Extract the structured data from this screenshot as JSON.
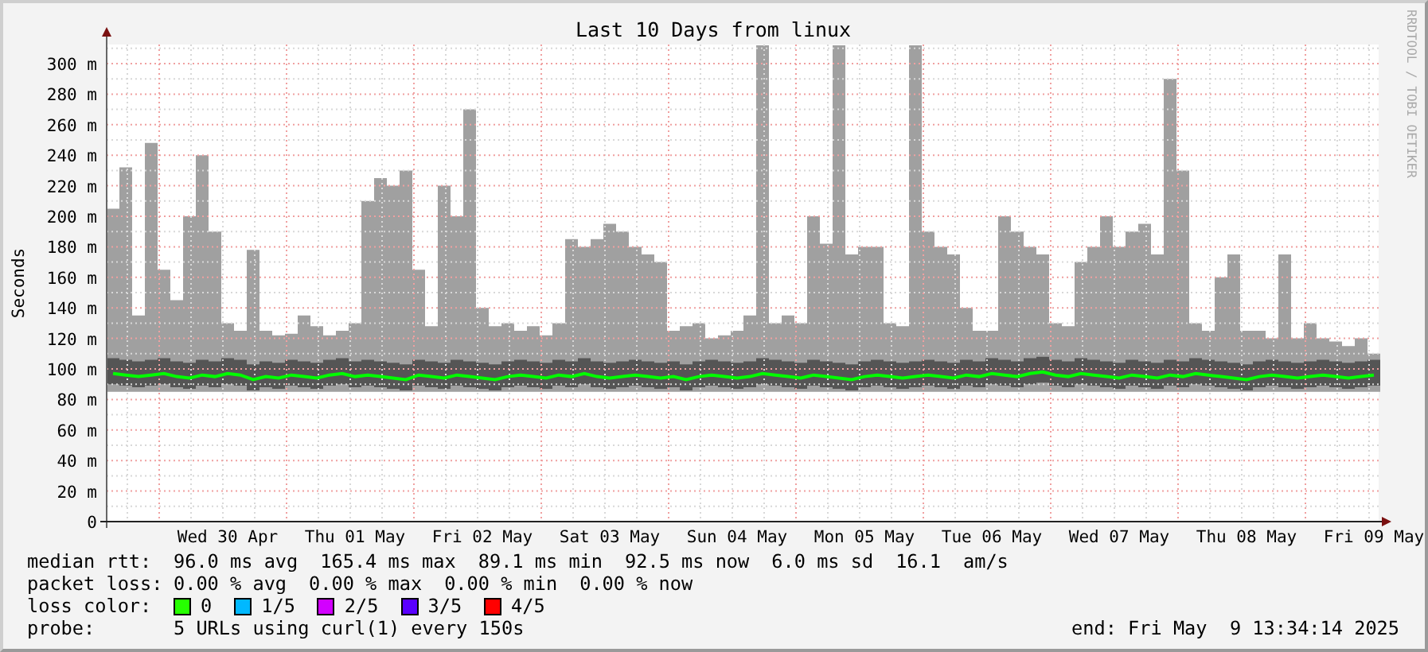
{
  "graph": {
    "title": "Last 10 Days from linux",
    "watermark": "RRDTOOL / TOBI OETIKER",
    "chart_data": {
      "type": "line",
      "ylabel": "Seconds",
      "ylim": [
        0,
        312.5
      ],
      "grid": true,
      "categories": [
        null,
        null,
        null,
        null,
        null,
        null,
        null,
        null,
        null,
        "Wed 30 Apr",
        null,
        null,
        null,
        null,
        null,
        null,
        null,
        null,
        null,
        "Thu 01 May",
        null,
        null,
        null,
        null,
        null,
        null,
        null,
        null,
        null,
        "Fri 02 May",
        null,
        null,
        null,
        null,
        null,
        null,
        null,
        null,
        null,
        "Sat 03 May",
        null,
        null,
        null,
        null,
        null,
        null,
        null,
        null,
        null,
        "Sun 04 May",
        null,
        null,
        null,
        null,
        null,
        null,
        null,
        null,
        null,
        "Mon 05 May",
        null,
        null,
        null,
        null,
        null,
        null,
        null,
        null,
        null,
        "Tue 06 May",
        null,
        null,
        null,
        null,
        null,
        null,
        null,
        null,
        null,
        "Wed 07 May",
        null,
        null,
        null,
        null,
        null,
        null,
        null,
        null,
        null,
        "Thu 08 May",
        null,
        null,
        null,
        null,
        null,
        null,
        null,
        null,
        null,
        "Fri 09 May"
      ],
      "yticks": [
        {
          "value": 0,
          "label": "0"
        },
        {
          "value": 20,
          "label": "20 m"
        },
        {
          "value": 40,
          "label": "40 m"
        },
        {
          "value": 60,
          "label": "60 m"
        },
        {
          "value": 80,
          "label": "80 m"
        },
        {
          "value": 100,
          "label": "100 m"
        },
        {
          "value": 120,
          "label": "120 m"
        },
        {
          "value": 140,
          "label": "140 m"
        },
        {
          "value": 160,
          "label": "160 m"
        },
        {
          "value": 180,
          "label": "180 m"
        },
        {
          "value": 200,
          "label": "200 m"
        },
        {
          "value": 220,
          "label": "220 m"
        },
        {
          "value": 240,
          "label": "240 m"
        },
        {
          "value": 260,
          "label": "260 m"
        },
        {
          "value": 280,
          "label": "280 m"
        },
        {
          "value": 300,
          "label": "300 m"
        }
      ],
      "series": [
        {
          "color": "#00ff00",
          "values": [
            97,
            96,
            95,
            96,
            97,
            95,
            94,
            96,
            95,
            97,
            96,
            93,
            95,
            94,
            96,
            95,
            94,
            96,
            97,
            95,
            96,
            95,
            94,
            93,
            96,
            95,
            94,
            96,
            95,
            94,
            93,
            95,
            96,
            95,
            94,
            96,
            95,
            97,
            95,
            94,
            95,
            96,
            95,
            94,
            95,
            93,
            95,
            96,
            95,
            94,
            95,
            97,
            96,
            95,
            94,
            96,
            95,
            94,
            93,
            95,
            96,
            95,
            94,
            95,
            96,
            95,
            94,
            96,
            95,
            97,
            96,
            95,
            97,
            98,
            96,
            95,
            97,
            96,
            95,
            94,
            96,
            95,
            94,
            96,
            95,
            97,
            96,
            95,
            94,
            93,
            95,
            96,
            95,
            94,
            95,
            96,
            95,
            94,
            95,
            96
          ]
        }
      ]
    }
  },
  "legend": [
    {
      "kind": "stats",
      "label": "median rtt:",
      "items": [
        "96.0 ms avg",
        "165.4 ms max",
        "89.1 ms min",
        "92.5 ms now",
        "6.0 ms sd",
        "16.1",
        "am/s"
      ]
    },
    {
      "kind": "stats",
      "label": "packet loss:",
      "items": [
        "0.00 % avg",
        "0.00 % max",
        "0.00 % min",
        "0.00 % now"
      ]
    },
    {
      "kind": "colors",
      "label": "loss color:",
      "swatches": [
        {
          "label": "0",
          "color": "#26ff00"
        },
        {
          "label": "1/5",
          "color": "#00b8ff"
        },
        {
          "label": "2/5",
          "color": "#d200ff"
        },
        {
          "label": "3/5",
          "color": "#5a00ff"
        },
        {
          "label": "4/5",
          "color": "#ff0000"
        }
      ]
    },
    {
      "kind": "probe",
      "label": "probe:",
      "text": "5 URLs using curl(1) every 150s",
      "end": "end: Fri May  9 13:34:14 2025"
    }
  ]
}
